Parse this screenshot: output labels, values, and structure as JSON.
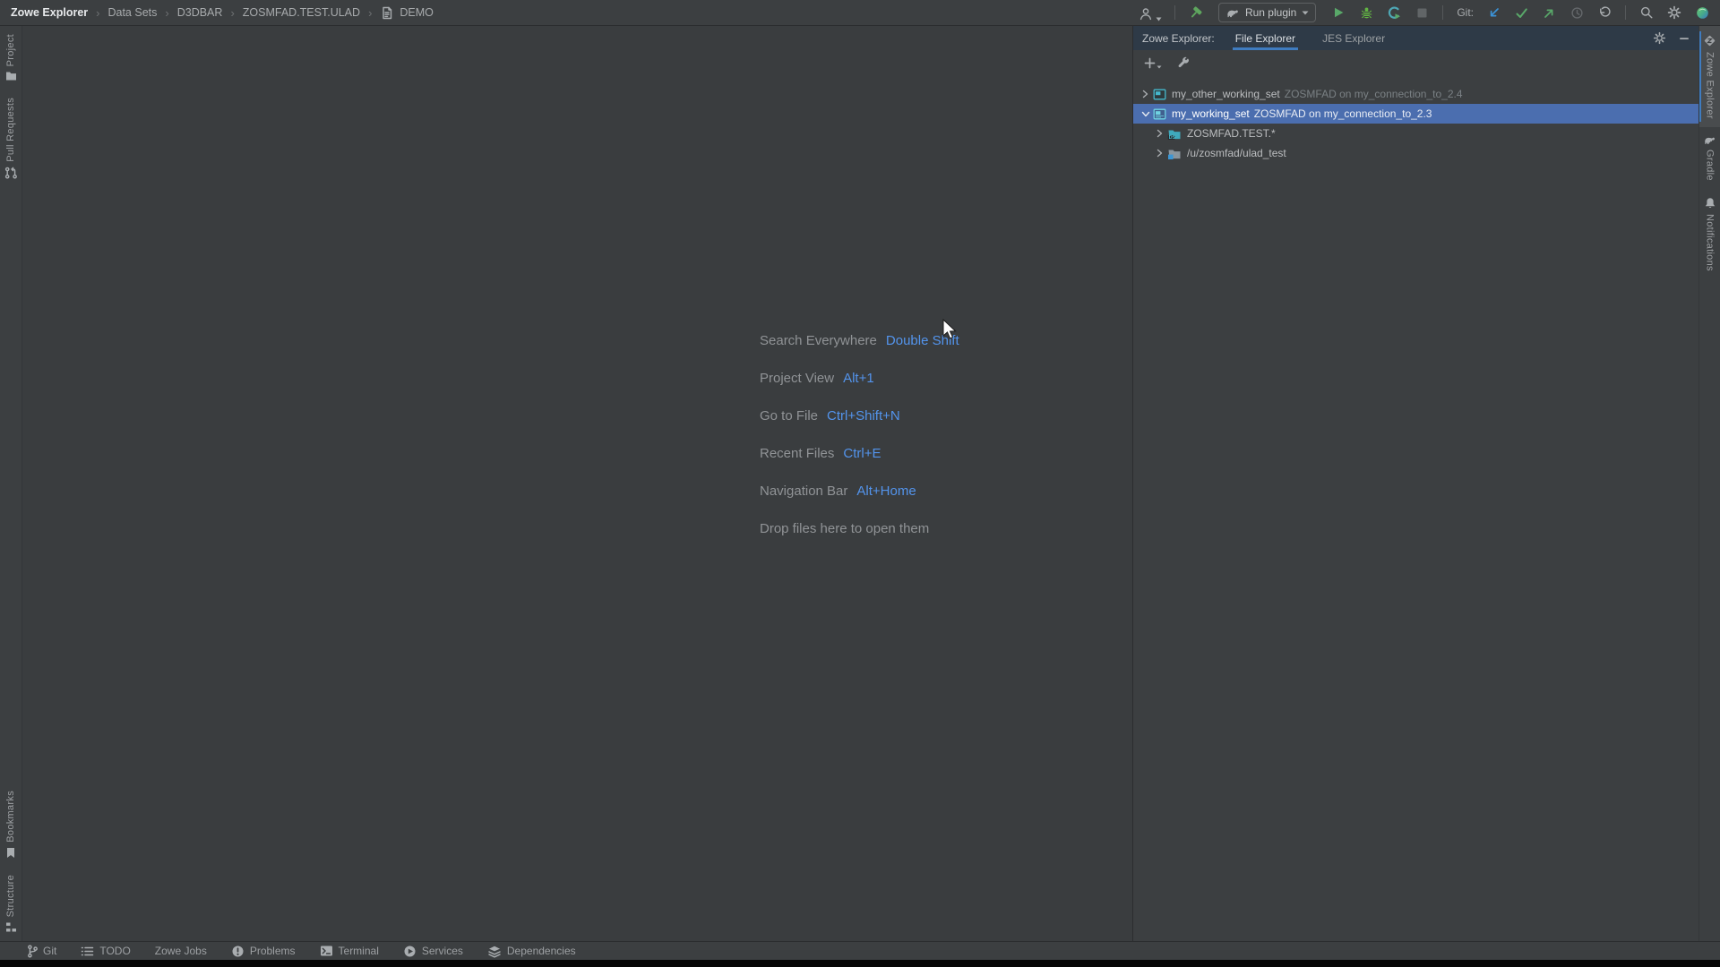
{
  "topbar": {
    "breadcrumbs": [
      "Zowe Explorer",
      "Data Sets",
      "D3DBAR",
      "ZOSMFAD.TEST.ULAD",
      "DEMO"
    ],
    "run_config_label": "Run plugin",
    "git_label": "Git:",
    "icon_names": [
      "user-icon",
      "build-hammer-icon",
      "gradle-elephant-icon",
      "run-icon",
      "debug-icon",
      "profiler-icon",
      "stop-icon",
      "git-update-icon",
      "git-commit-icon",
      "git-push-icon",
      "history-icon",
      "rollback-icon",
      "search-icon",
      "settings-icon",
      "profile-sphere-icon"
    ]
  },
  "left_stripe": {
    "top": [
      {
        "label": "Project",
        "icon": "folder-icon"
      },
      {
        "label": "Pull Requests",
        "icon": "pull-request-icon"
      }
    ],
    "bottom": [
      {
        "label": "Bookmarks",
        "icon": "bookmark-icon"
      },
      {
        "label": "Structure",
        "icon": "structure-icon"
      }
    ]
  },
  "right_stripe": [
    {
      "label": "Zowe Explorer",
      "icon": "zowe-logo-icon",
      "active": true
    },
    {
      "label": "Gradle",
      "icon": "gradle-elephant-icon",
      "active": false
    },
    {
      "label": "Notifications",
      "icon": "bell-icon",
      "active": false
    }
  ],
  "tool_window": {
    "title": "Zowe Explorer:",
    "tabs": [
      {
        "label": "File Explorer",
        "active": true
      },
      {
        "label": "JES Explorer",
        "active": false
      }
    ],
    "toolbar_icon_names": [
      "add-icon",
      "wrench-icon"
    ],
    "header_icon_names": [
      "gear-icon",
      "hide-icon"
    ],
    "tree": [
      {
        "label": "my_other_working_set",
        "detail": "ZOSMFAD on my_connection_to_2.4",
        "state": "collapsed",
        "selected": false,
        "level": 0,
        "icon": "working-set-icon"
      },
      {
        "label": "my_working_set",
        "detail": "ZOSMFAD on my_connection_to_2.3",
        "state": "expanded",
        "selected": true,
        "level": 0,
        "icon": "working-set-icon"
      },
      {
        "label": "ZOSMFAD.TEST.*",
        "detail": "",
        "state": "collapsed",
        "selected": false,
        "level": 1,
        "icon": "dataset-folder-icon"
      },
      {
        "label": "/u/zosmfad/ulad_test",
        "detail": "",
        "state": "collapsed",
        "selected": false,
        "level": 1,
        "icon": "uss-folder-icon"
      }
    ]
  },
  "editor": {
    "shortcuts": [
      {
        "label": "Search Everywhere",
        "keys": "Double Shift"
      },
      {
        "label": "Project View",
        "keys": "Alt+1"
      },
      {
        "label": "Go to File",
        "keys": "Ctrl+Shift+N"
      },
      {
        "label": "Recent Files",
        "keys": "Ctrl+E"
      },
      {
        "label": "Navigation Bar",
        "keys": "Alt+Home"
      }
    ],
    "drop_hint": "Drop files here to open them"
  },
  "statusbar": {
    "items": [
      {
        "label": "Git",
        "icon": "git-branch-icon"
      },
      {
        "label": "TODO",
        "icon": "todo-list-icon"
      },
      {
        "label": "Zowe Jobs",
        "icon": ""
      },
      {
        "label": "Problems",
        "icon": "problems-icon"
      },
      {
        "label": "Terminal",
        "icon": "terminal-icon"
      },
      {
        "label": "Services",
        "icon": "services-icon"
      },
      {
        "label": "Dependencies",
        "icon": "dependencies-icon"
      }
    ]
  },
  "colors": {
    "panel_bg": "#3C3F41",
    "editor_bg": "#3A3D3F",
    "header_bg": "#2E3A47",
    "selection_blue": "#4B6EAF",
    "accent_blue": "#3F7CC0",
    "shortcut_blue": "#5394EC",
    "run_green": "#59A869",
    "git_update_blue": "#3B92D6",
    "workingset_teal": "#45B8CC"
  }
}
